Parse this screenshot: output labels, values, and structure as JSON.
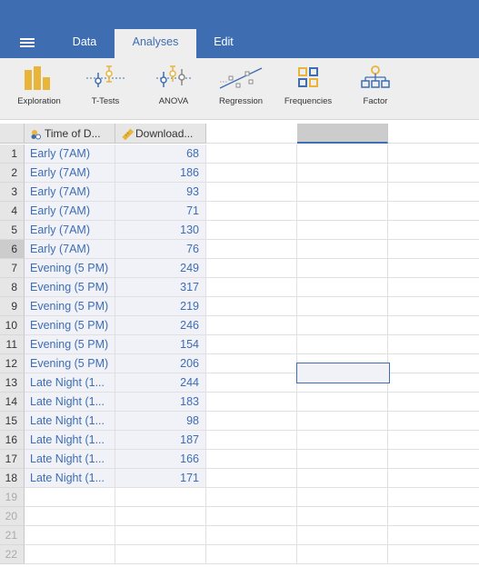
{
  "app": {
    "tabs": [
      {
        "label": "Data"
      },
      {
        "label": "Analyses"
      },
      {
        "label": "Edit"
      }
    ],
    "active_tab": "Analyses",
    "accent_color": "#3e6db2",
    "icon_yellow": "#e8b53a"
  },
  "ribbon": {
    "items": [
      {
        "label": "Exploration",
        "icon": "bar-chart-icon"
      },
      {
        "label": "T-Tests",
        "icon": "t-tests-icon"
      },
      {
        "label": "ANOVA",
        "icon": "anova-icon"
      },
      {
        "label": "Regression",
        "icon": "regression-icon"
      },
      {
        "label": "Frequencies",
        "icon": "frequencies-icon"
      },
      {
        "label": "Factor",
        "icon": "factor-icon"
      }
    ]
  },
  "grid": {
    "columns": [
      {
        "name": "Time of D...",
        "type": "nominal"
      },
      {
        "name": "Download...",
        "type": "continuous"
      }
    ],
    "rows": [
      {
        "n": "1",
        "time": "Early (7AM)",
        "downloads": "68"
      },
      {
        "n": "2",
        "time": "Early (7AM)",
        "downloads": "186"
      },
      {
        "n": "3",
        "time": "Early (7AM)",
        "downloads": "93"
      },
      {
        "n": "4",
        "time": "Early (7AM)",
        "downloads": "71"
      },
      {
        "n": "5",
        "time": "Early (7AM)",
        "downloads": "130"
      },
      {
        "n": "6",
        "time": "Early (7AM)",
        "downloads": "76"
      },
      {
        "n": "7",
        "time": "Evening (5 PM)",
        "downloads": "249"
      },
      {
        "n": "8",
        "time": "Evening (5 PM)",
        "downloads": "317"
      },
      {
        "n": "9",
        "time": "Evening (5 PM)",
        "downloads": "219"
      },
      {
        "n": "10",
        "time": "Evening (5 PM)",
        "downloads": "246"
      },
      {
        "n": "11",
        "time": "Evening (5 PM)",
        "downloads": "154"
      },
      {
        "n": "12",
        "time": "Evening (5 PM)",
        "downloads": "206"
      },
      {
        "n": "13",
        "time": "Late Night (1...",
        "downloads": "244"
      },
      {
        "n": "14",
        "time": "Late Night (1...",
        "downloads": "183"
      },
      {
        "n": "15",
        "time": "Late Night (1...",
        "downloads": "98"
      },
      {
        "n": "16",
        "time": "Late Night (1...",
        "downloads": "187"
      },
      {
        "n": "17",
        "time": "Late Night (1...",
        "downloads": "166"
      },
      {
        "n": "18",
        "time": "Late Night (1...",
        "downloads": "171"
      }
    ],
    "empty_rows": [
      "19",
      "20",
      "21",
      "22"
    ],
    "selected_row": "6"
  }
}
